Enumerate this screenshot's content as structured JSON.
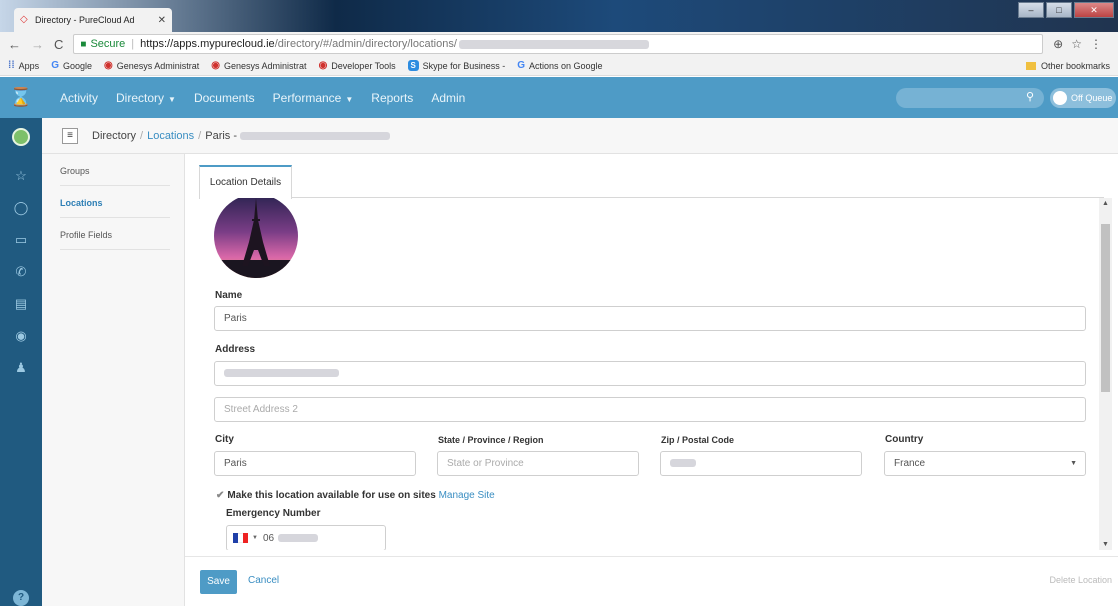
{
  "browser": {
    "tab_title": "Directory - PureCloud Ad",
    "url_secure": "Secure",
    "url_host": "https://apps.mypurecloud.ie",
    "url_path": "/directory/#/admin/directory/locations/",
    "bookmarks": [
      {
        "icon": "apps-grid-icon",
        "label": "Apps"
      },
      {
        "icon": "google-icon",
        "label": "Google"
      },
      {
        "icon": "genesys-icon",
        "label": "Genesys Administrat"
      },
      {
        "icon": "genesys-icon",
        "label": "Genesys Administrat"
      },
      {
        "icon": "genesys-icon",
        "label": "Developer Tools"
      },
      {
        "icon": "skype-icon",
        "label": "Skype for Business -"
      },
      {
        "icon": "google-icon",
        "label": "Actions on Google"
      }
    ],
    "other_bookmarks": "Other bookmarks"
  },
  "nav": {
    "items": [
      "Activity",
      "Directory",
      "Documents",
      "Performance",
      "Reports",
      "Admin"
    ],
    "queue_label": "Off Queue"
  },
  "breadcrumb": {
    "directory": "Directory",
    "locations": "Locations",
    "current": "Paris -"
  },
  "sidebar": {
    "items": [
      "Groups",
      "Locations",
      "Profile Fields"
    ],
    "active_index": 1
  },
  "tab_label": "Location Details",
  "form": {
    "name_label": "Name",
    "name_value": "Paris",
    "address_label": "Address",
    "street2_placeholder": "Street Address 2",
    "city_label": "City",
    "city_value": "Paris",
    "state_label": "State / Province / Region",
    "state_placeholder": "State or Province",
    "zip_label": "Zip / Postal Code",
    "country_label": "Country",
    "country_value": "France",
    "sites_label": "Make this location available for use on sites",
    "manage_site": "Manage Site",
    "emergency_label": "Emergency Number",
    "phone_prefix": "06"
  },
  "footer": {
    "save": "Save",
    "cancel": "Cancel",
    "delete": "Delete Location"
  },
  "colors": {
    "brand": "#4e9bc6",
    "rail": "#205a80",
    "link": "#3a8ec2"
  }
}
